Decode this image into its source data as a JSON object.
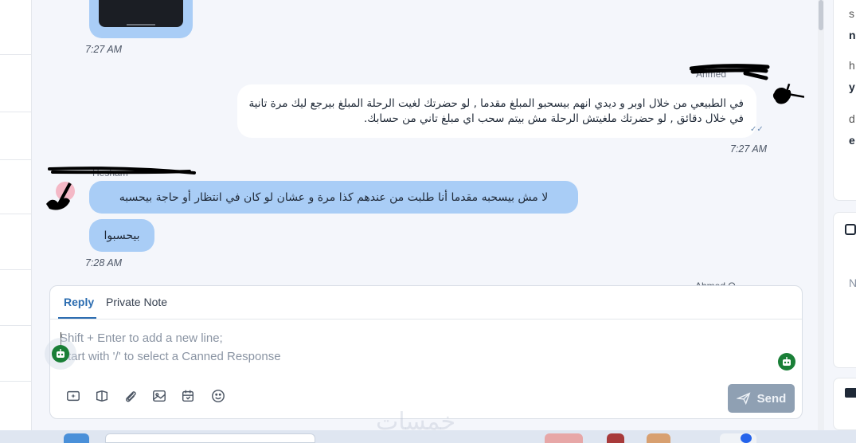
{
  "conversation": {
    "messages": [
      {
        "direction": "incoming",
        "type": "image",
        "time": "7:27 AM"
      },
      {
        "direction": "outgoing",
        "sender": "Ahmed",
        "text": "في الطبيعي من خلال اوبر و ديدي انهم بيسحبو المبلغ مقدما , لو حضرتك لغيت الرحلة المبلغ بيرجع ليك مرة تانية في خلال دقائق , لو حضرتك ملغيتش الرحلة مش بيتم سحب اي مبلغ تاني من حسابك.",
        "status": "✓✓",
        "time": "7:27 AM"
      },
      {
        "direction": "incoming",
        "sender": "Hesham",
        "text": "لا مش بيسحبه مقدما أنا طلبت من عندهم كذا مرة و عشان لو كان في انتظار أو حاجة بيحسبه"
      },
      {
        "direction": "incoming",
        "text": "بيحسبوا",
        "time": "7:28 AM"
      }
    ],
    "peek_sender": "Ahmed O"
  },
  "reply_box": {
    "tabs": [
      "Reply",
      "Private Note"
    ],
    "active_tab": "Reply",
    "placeholder_line1": "Shift + Enter to add a new line;",
    "placeholder_line2": "Start with '/' to select a Canned Response",
    "send_label": "Send",
    "tools": [
      "emoji-picker-icon",
      "article-icon",
      "attachment-icon",
      "image-icon",
      "calendar-icon",
      "smiley-icon"
    ]
  },
  "right_panel": {
    "letters": [
      "s",
      "n",
      "h",
      "y",
      "d",
      "e",
      "N"
    ]
  },
  "watermark": "خمسات",
  "colors": {
    "accent": "#2b6cb0",
    "incoming_bubble": "#a9cdf6",
    "outgoing_bubble": "#ffffff",
    "send_button": "#8fa0b3",
    "bot_icon": "#1a7f37"
  }
}
